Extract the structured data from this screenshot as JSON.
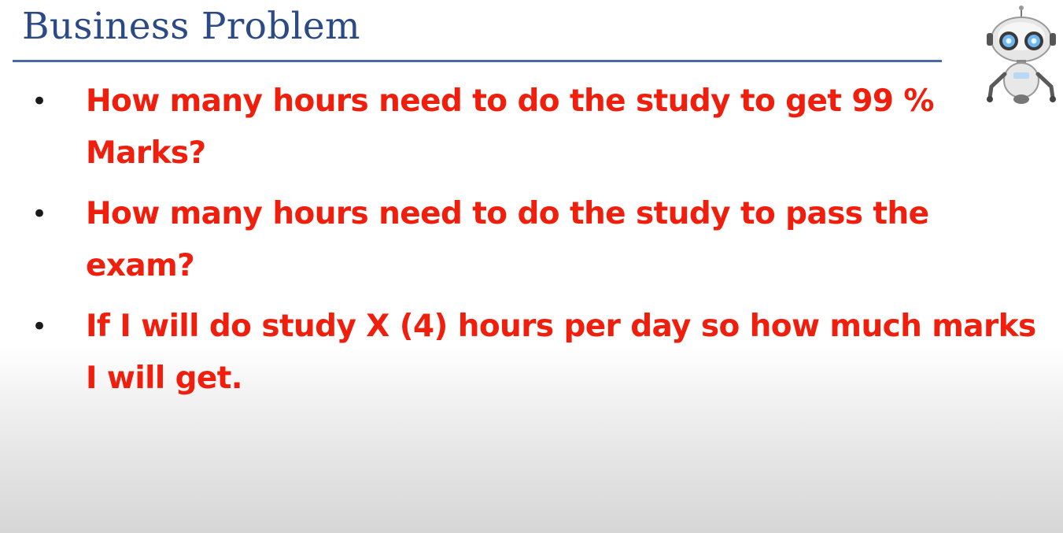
{
  "slide": {
    "title": "Business Problem",
    "bullets": [
      {
        "line1": "How many hours need to do the study to get 99 %",
        "line2": "Marks?"
      },
      {
        "line1": "How many hours need to do the study to pass the",
        "line2": "exam?"
      },
      {
        "line1": "If I will do study X (4) hours per day so how much marks",
        "line2": "I will get."
      }
    ]
  },
  "colors": {
    "title": "#2b4a86",
    "rule": "#4a6aa6",
    "bullet_text": "#f01e0c",
    "bullet_dot": "#1a1a1a"
  },
  "icons": {
    "corner_image": "robot-icon"
  }
}
